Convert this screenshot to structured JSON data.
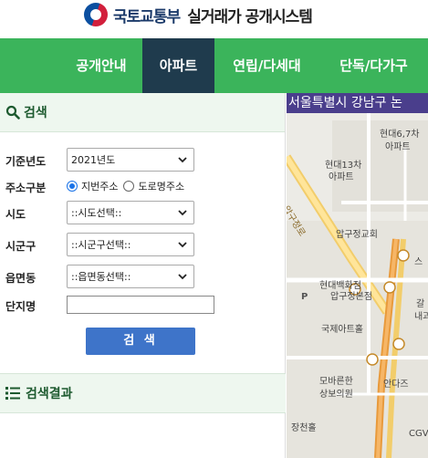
{
  "header": {
    "ministry": "국토교통부",
    "system": "실거래가 공개시스템"
  },
  "nav": {
    "tabs": [
      {
        "label": "공개안내",
        "active": false
      },
      {
        "label": "아파트",
        "active": true
      },
      {
        "label": "연립/다세대",
        "active": false
      },
      {
        "label": "단독/다가구",
        "active": false
      }
    ]
  },
  "search": {
    "title": "검색",
    "year_label": "기준년도",
    "year_value": "2021년도",
    "address_type_label": "주소구분",
    "address_options": [
      "지번주소",
      "도로명주소"
    ],
    "address_selected": "지번주소",
    "sido_label": "시도",
    "sido_value": "::시도선택::",
    "sigungu_label": "시군구",
    "sigungu_value": "::시군구선택::",
    "eupmyeondong_label": "읍면동",
    "eupmyeondong_value": "::읍면동선택::",
    "complex_label": "단지명",
    "complex_value": "",
    "button_label": "검 색"
  },
  "results": {
    "title": "검색결과"
  },
  "map": {
    "banner": "서울특별시 강남구 논",
    "labels": [
      "현대6,7차",
      "아파트",
      "현대13차",
      "아파트",
      "압구정교회",
      "현대백화점",
      "압구정본점",
      "국제아트홀",
      "모바른한",
      "상보의원",
      "안다즈",
      "장천홀",
      "압구정로",
      "P",
      "스",
      "갈",
      "내과",
      "CGV"
    ]
  },
  "colors": {
    "nav_green": "#3bb45b",
    "nav_active": "#1f3b4d",
    "button_blue": "#3e74c9",
    "map_banner": "#4a3e8c"
  }
}
